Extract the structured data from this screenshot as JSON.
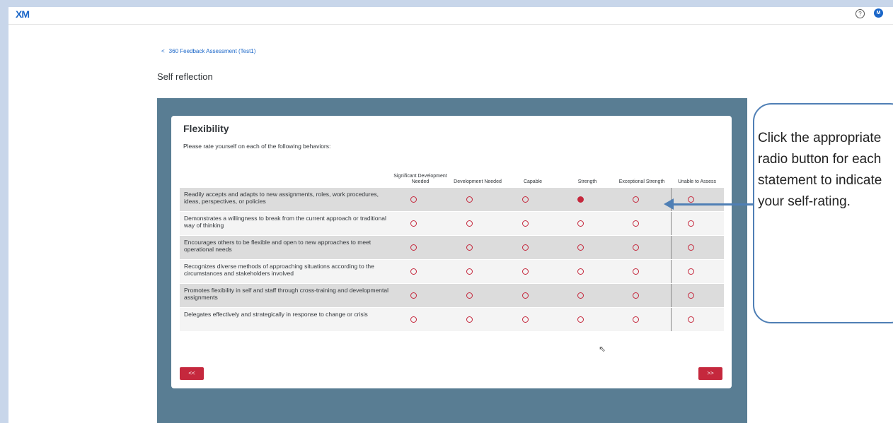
{
  "app": {
    "logo": "XM",
    "help_icon": "?",
    "avatar_initial": "M"
  },
  "breadcrumb": {
    "chevron": "<",
    "label": "360 Feedback Assessment (Test1)"
  },
  "page_title": "Self reflection",
  "card": {
    "title": "Flexibility",
    "instructions": "Please rate yourself on each of the following behaviors:",
    "columns": [
      "Significant Development Needed",
      "Development Needed",
      "Capable",
      "Strength",
      "Exceptional Strength",
      "Unable to Assess"
    ],
    "rows": [
      {
        "statement": "Readily accepts and adapts to new assignments, roles, work procedures, ideas, perspectives, or policies",
        "selected": 3
      },
      {
        "statement": "Demonstrates a willingness to break from the current approach or traditional way of thinking",
        "selected": null
      },
      {
        "statement": "Encourages others to be flexible and open to new approaches to meet operational needs",
        "selected": null
      },
      {
        "statement": "Recognizes diverse methods of approaching situations according to the circumstances and stakeholders involved",
        "selected": null
      },
      {
        "statement": "Promotes flexibility in self and staff through cross-training and developmental assignments",
        "selected": null
      },
      {
        "statement": "Delegates effectively and strategically in response to change or crisis",
        "selected": null
      }
    ],
    "prev_label": "<<",
    "next_label": ">>"
  },
  "callout": {
    "text": "Click the appropriate radio button for each statement to indicate your self-rating."
  },
  "colors": {
    "accent": "#c5283d",
    "panel": "#597d93",
    "brand": "#1a66c8",
    "callout_border": "#4f7fb5"
  }
}
